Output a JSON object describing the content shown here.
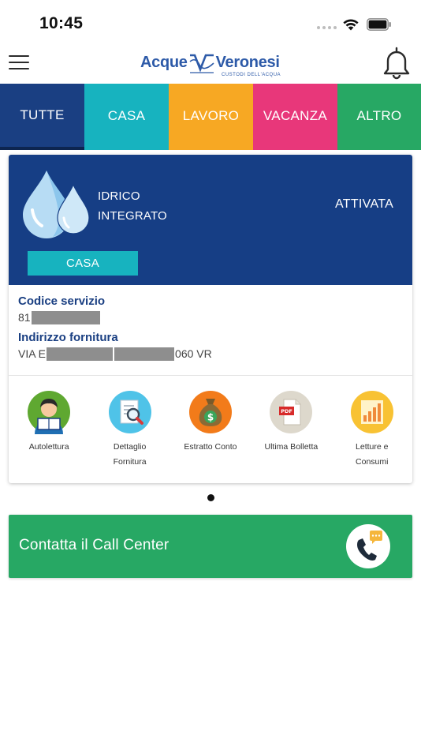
{
  "status_bar": {
    "time": "10:45"
  },
  "header": {
    "logo_left": "Acque",
    "logo_right": "Veronesi",
    "logo_tagline": "CUSTODI DELL'ACQUA"
  },
  "tabs": [
    {
      "label": "TUTTE",
      "color": "#1a3f82",
      "selected": true
    },
    {
      "label": "CASA",
      "color": "#17b3bf"
    },
    {
      "label": "LAVORO",
      "color": "#f7a823"
    },
    {
      "label": "VACANZA",
      "color": "#e8377a"
    },
    {
      "label": "ALTRO",
      "color": "#27a864"
    }
  ],
  "card": {
    "service_type_line1": "IDRICO",
    "service_type_line2": "INTEGRATO",
    "status": "ATTIVATA",
    "tag": "CASA",
    "codice_label": "Codice servizio",
    "codice_value_prefix": "81",
    "indirizzo_label": "Indirizzo fornitura",
    "indirizzo_value_prefix": "VIA E",
    "indirizzo_value_suffix": "060 VR",
    "actions": [
      {
        "label_line1": "Autolettura",
        "label_line2": "",
        "icon": "reader-avatar-icon"
      },
      {
        "label_line1": "Dettaglio",
        "label_line2": "Fornitura",
        "icon": "document-search-icon"
      },
      {
        "label_line1": "Estratto Conto",
        "label_line2": "",
        "icon": "money-bag-icon"
      },
      {
        "label_line1": "Ultima Bolletta",
        "label_line2": "",
        "icon": "pdf-icon"
      },
      {
        "label_line1": "Letture e",
        "label_line2": "Consumi",
        "icon": "bar-chart-icon"
      }
    ]
  },
  "call_center": {
    "label": "Contatta il Call Center"
  },
  "colors": {
    "primary": "#1a3f82",
    "teal": "#17b3bf",
    "orange": "#f7a823",
    "pink": "#e8377a",
    "green": "#27a864"
  }
}
